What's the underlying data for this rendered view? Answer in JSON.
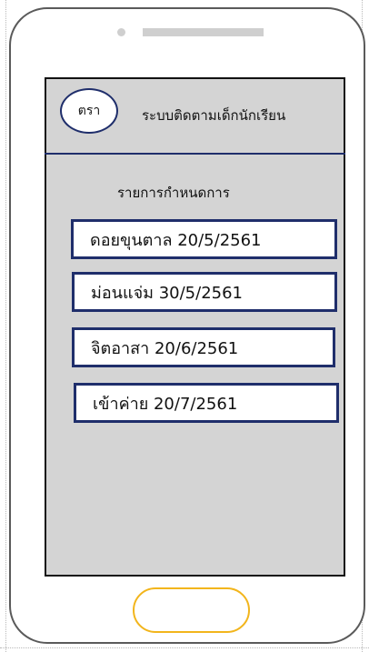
{
  "header": {
    "logo_text": "ตรา",
    "app_title": "ระบบติดตามเด็กนักเรียน"
  },
  "main": {
    "section_title": "รายการกำหนดการ",
    "items": [
      {
        "label": "ดอยขุนตาล 20/5/2561"
      },
      {
        "label": "ม่อนแจ่ม 30/5/2561"
      },
      {
        "label": "จิตอาสา 20/6/2561"
      },
      {
        "label": "เข้าค่าย 20/7/2561"
      }
    ]
  },
  "colors": {
    "accent_navy": "#1f2e6b",
    "home_button_outline": "#f2b51c",
    "screen_background": "#d4d4d4"
  }
}
